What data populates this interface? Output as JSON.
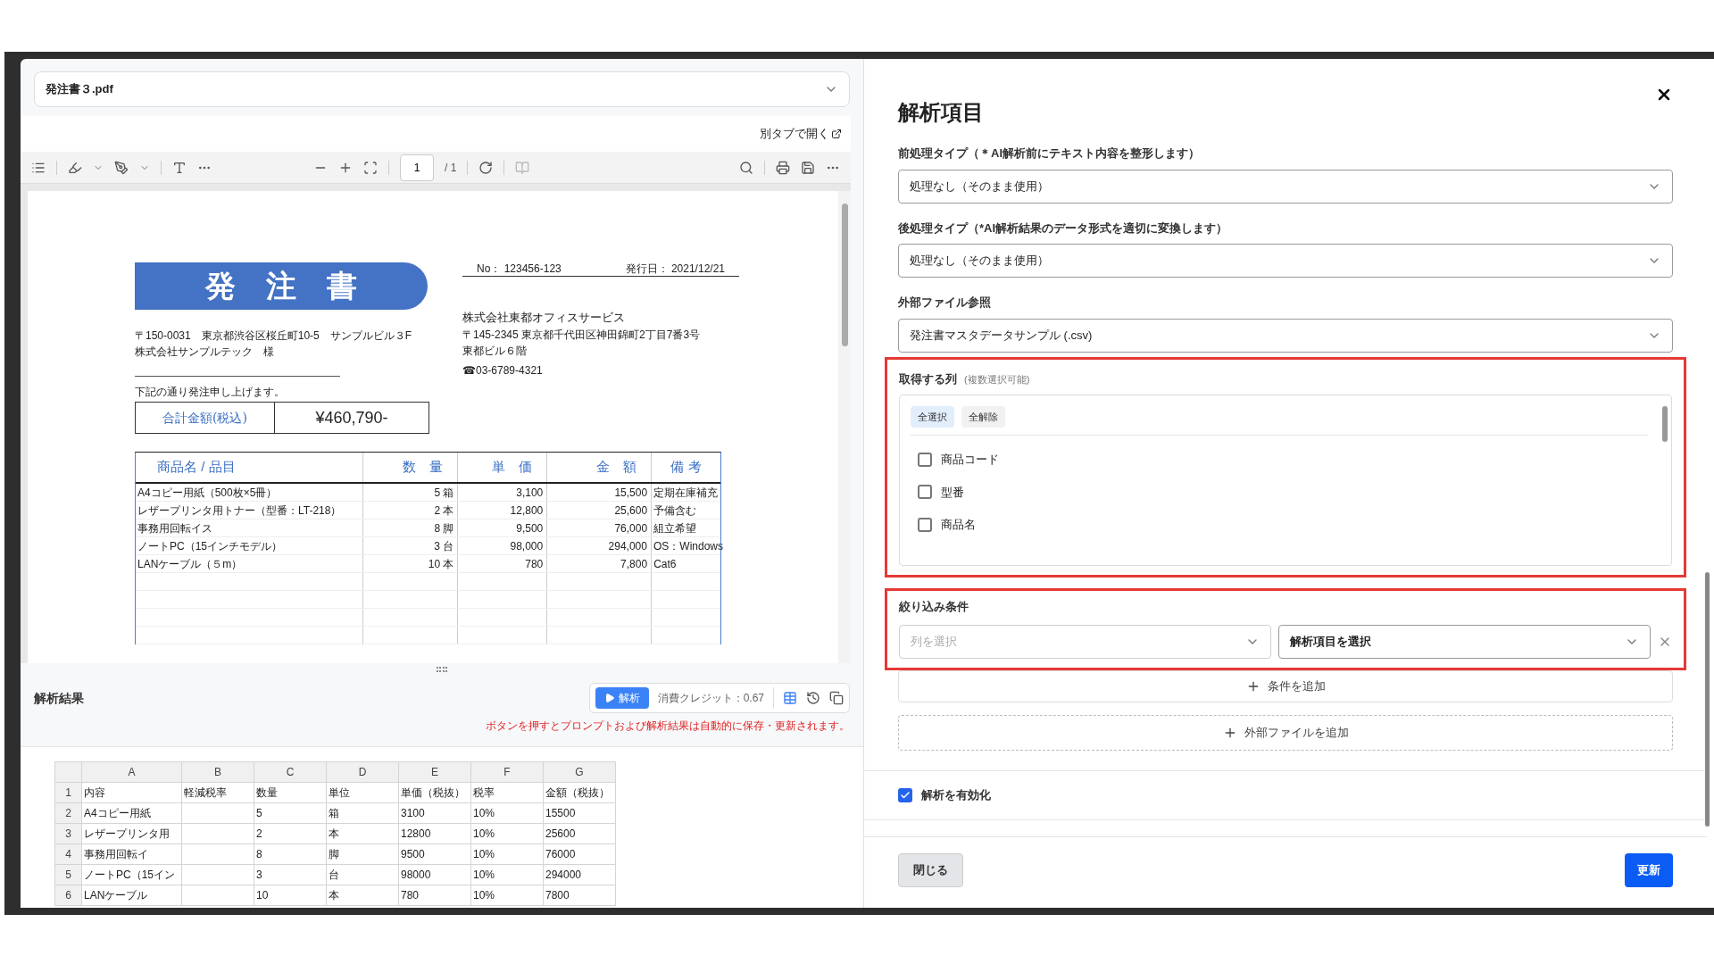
{
  "viewer": {
    "file_select": {
      "value": "発注書３.pdf"
    },
    "open_in_new_tab": "別タブで開く",
    "page_input": "1",
    "page_total": "/ 1"
  },
  "document": {
    "title": "発　注　書",
    "number": "No：  123456-123",
    "issued": "発行日：  2021/12/21",
    "recipient_address": "〒150-0031　東京都渋谷区桜丘町10-5　サンプルビル３F",
    "recipient_name": "株式会社サンプルテック　様",
    "sender_lines": [
      "株式会社東都オフィスサービス",
      "〒145-2345 東京都千代田区神田錦町2丁目7番3号",
      "東都ビル６階",
      "☎03-6789-4321"
    ],
    "intro": "下記の通り発注申し上げます。",
    "total_label": "合計金額(税込)",
    "total_value": "¥460,790-",
    "columns": [
      "商品名 / 品目",
      "数　量",
      "単　価",
      "金　額",
      "備 考"
    ],
    "rows": [
      {
        "name": "A4コピー用紙（500枚×5冊）",
        "quantity": "5 箱",
        "unit_price": "3,100",
        "amount": "15,500",
        "note": "定期在庫補充"
      },
      {
        "name": "レザープリンタ用トナー（型番：LT-218）",
        "quantity": "2 本",
        "unit_price": "12,800",
        "amount": "25,600",
        "note": "予備含む"
      },
      {
        "name": "事務用回転イス",
        "quantity": "8 脚",
        "unit_price": "9,500",
        "amount": "76,000",
        "note": "組立希望"
      },
      {
        "name": "ノートPC（15インチモデル）",
        "quantity": "3 台",
        "unit_price": "98,000",
        "amount": "294,000",
        "note": "OS：Windows"
      },
      {
        "name": "LANケーブル（５m）",
        "quantity": "10 本",
        "unit_price": "780",
        "amount": "7,800",
        "note": "Cat6"
      }
    ]
  },
  "results": {
    "title": "解析結果",
    "run_button": "解析",
    "credit": "消費クレジット：0.67",
    "notice": "ボタンを押すとプロンプトおよび解析結果は自動的に保存・更新されます。",
    "sheet": {
      "columns": [
        "A",
        "B",
        "C",
        "D",
        "E",
        "F",
        "G"
      ],
      "rows": [
        {
          "number": "1",
          "cells": [
            "内容",
            "軽減税率",
            "数量",
            "単位",
            "単価（税抜）",
            "税率",
            "金額（税抜）"
          ]
        },
        {
          "number": "2",
          "cells": [
            "A4コピー用紙",
            null,
            "5",
            "箱",
            "3100",
            "10%",
            "15500"
          ]
        },
        {
          "number": "3",
          "cells": [
            "レザープリンタ用",
            null,
            "2",
            "本",
            "12800",
            "10%",
            "25600"
          ]
        },
        {
          "number": "4",
          "cells": [
            "事務用回転イ",
            null,
            "8",
            "脚",
            "9500",
            "10%",
            "76000"
          ]
        },
        {
          "number": "5",
          "cells": [
            "ノートPC（15イン",
            null,
            "3",
            "台",
            "98000",
            "10%",
            "294000"
          ]
        },
        {
          "number": "6",
          "cells": [
            "LANケーブル",
            null,
            "10",
            "本",
            "780",
            "10%",
            "7800"
          ]
        }
      ]
    }
  },
  "panel": {
    "title": "解析項目",
    "fields": [
      {
        "label": "前処理タイプ（＊AI解析前にテキスト内容を整形します）",
        "value": "処理なし（そのまま使用）"
      },
      {
        "label": "後処理タイプ（*AI解析結果のデータ形式を適切に変換します）",
        "value": "処理なし（そのまま使用）"
      },
      {
        "label": "外部ファイル参照",
        "value": "発注書マスタデータサンプル (.csv)"
      }
    ],
    "columns_section": {
      "label": "取得する列",
      "hint": "(複数選択可能)",
      "actions": [
        {
          "label": "全選択",
          "highlighted": true
        },
        {
          "label": "全解除",
          "highlighted": false
        }
      ],
      "options": [
        {
          "label": "商品コード",
          "checked": false
        },
        {
          "label": "型番",
          "checked": false
        },
        {
          "label": "商品名",
          "checked": false
        }
      ]
    },
    "filter": {
      "label": "絞り込み条件",
      "column_placeholder": "列を選択",
      "item_value": "解析項目を選択",
      "add_condition": "条件を追加"
    },
    "add_file": "外部ファイルを追加",
    "enable": {
      "label": "解析を有効化",
      "checked": true
    },
    "close_button": "閉じる",
    "update_button": "更新"
  }
}
